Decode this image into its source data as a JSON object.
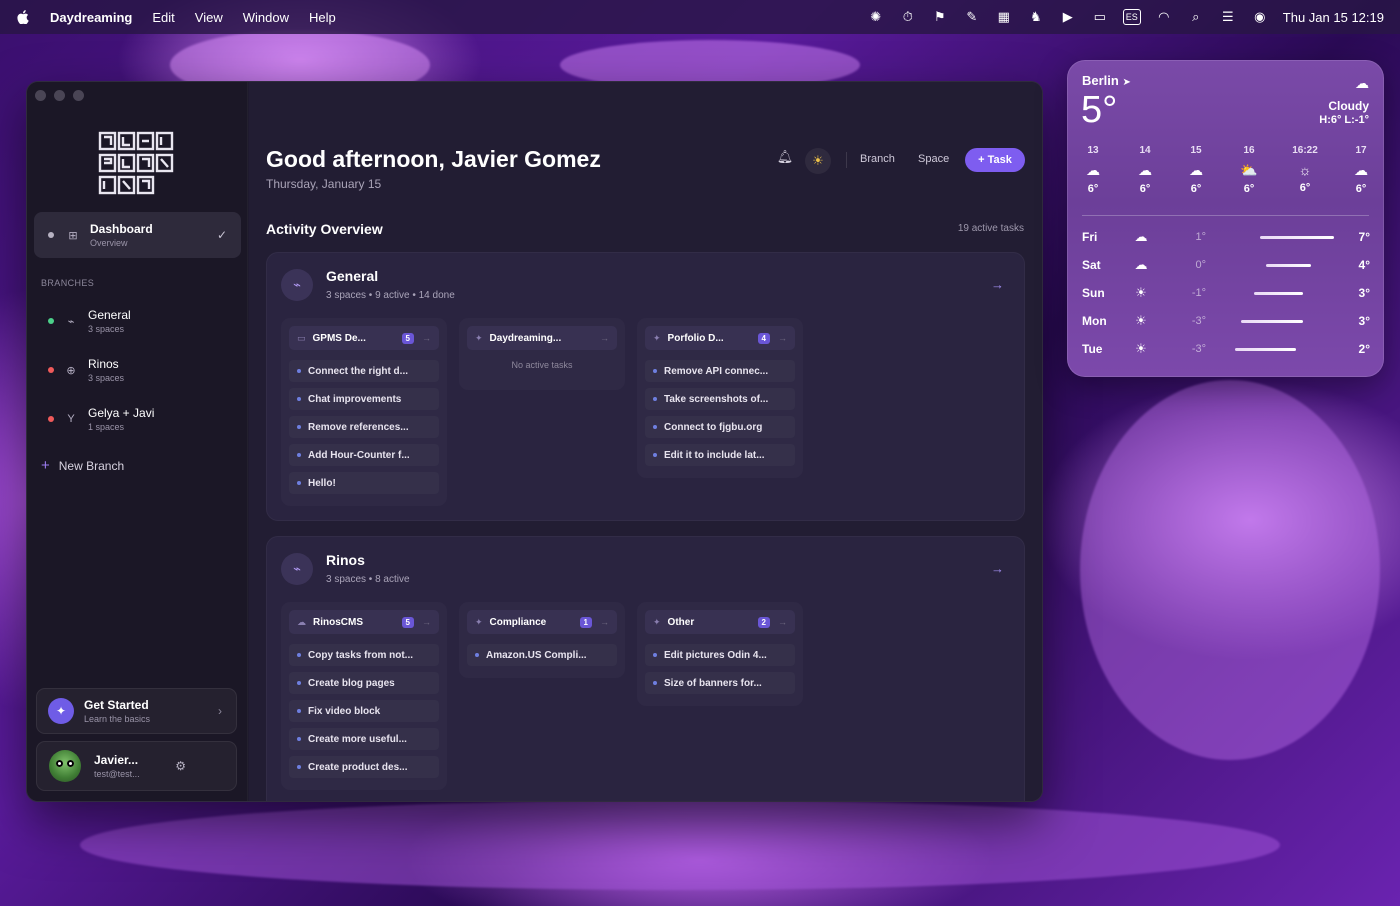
{
  "menubar": {
    "app": "Daydreaming",
    "items": [
      "Edit",
      "View",
      "Window",
      "Help"
    ],
    "input_source": "ES",
    "clock": "Thu Jan 15  12:19"
  },
  "sidebar": {
    "dashboard": {
      "label": "Dashboard",
      "sub": "Overview"
    },
    "branches_heading": "BRANCHES",
    "branches": [
      {
        "label": "General",
        "sub": "3 spaces",
        "color": "#4cd08a"
      },
      {
        "label": "Rinos",
        "sub": "3 spaces",
        "color": "#f05a5a"
      },
      {
        "label": "Gelya + Javi",
        "sub": "1 spaces",
        "color": "#f05a5a"
      }
    ],
    "new_branch": "New Branch",
    "get_started": {
      "title": "Get Started",
      "sub": "Learn the basics"
    },
    "user": {
      "name": "Javier...",
      "email": "test@test..."
    }
  },
  "header": {
    "greeting": "Good afternoon, Javier Gomez",
    "date": "Thursday, January 15",
    "branch_label": "Branch",
    "space_label": "Space",
    "task_label": "+ Task"
  },
  "activity": {
    "title": "Activity Overview",
    "count": "19 active tasks"
  },
  "groups": [
    {
      "title": "General",
      "meta": "3 spaces • 9 active • 14 done",
      "spaces": [
        {
          "name": "GPMS De...",
          "badge": "5",
          "tasks": [
            "Connect the right d...",
            "Chat improvements",
            "Remove references...",
            "Add Hour-Counter f...",
            "Hello!"
          ]
        },
        {
          "name": "Daydreaming...",
          "badge": "",
          "empty": "No active tasks",
          "tasks": []
        },
        {
          "name": "Porfolio D...",
          "badge": "4",
          "tasks": [
            "Remove API connec...",
            "Take screenshots of...",
            "Connect to fjgbu.org",
            "Edit it to include lat..."
          ]
        }
      ]
    },
    {
      "title": "Rinos",
      "meta": "3 spaces • 8 active",
      "spaces": [
        {
          "name": "RinosCMS",
          "badge": "5",
          "tasks": [
            "Copy tasks from not...",
            "Create blog pages",
            "Fix video block",
            "Create more useful...",
            "Create product des..."
          ]
        },
        {
          "name": "Compliance",
          "badge": "1",
          "tasks": [
            "Amazon.US Compli..."
          ]
        },
        {
          "name": "Other",
          "badge": "2",
          "tasks": [
            "Edit pictures Odin 4...",
            "Size of banners for..."
          ]
        }
      ]
    }
  ],
  "weather": {
    "city": "Berlin",
    "temp": "5°",
    "condition": "Cloudy",
    "hilo": "H:6° L:-1°",
    "hourly": [
      {
        "t": "13",
        "v": "6°",
        "icon": "cloud-icon"
      },
      {
        "t": "14",
        "v": "6°",
        "icon": "cloud-icon"
      },
      {
        "t": "15",
        "v": "6°",
        "icon": "cloud-icon"
      },
      {
        "t": "16",
        "v": "6°",
        "icon": "partly-cloudy-icon"
      },
      {
        "t": "16:22",
        "v": "6°",
        "icon": "sunset-icon"
      },
      {
        "t": "17",
        "v": "6°",
        "icon": "cloud-icon"
      }
    ],
    "daily": [
      {
        "d": "Fri",
        "lo": "1°",
        "hi": "7°",
        "icon": "cloud-icon"
      },
      {
        "d": "Sat",
        "lo": "0°",
        "hi": "4°",
        "icon": "cloud-icon"
      },
      {
        "d": "Sun",
        "lo": "-1°",
        "hi": "3°",
        "icon": "sun-icon"
      },
      {
        "d": "Mon",
        "lo": "-3°",
        "hi": "3°",
        "icon": "sun-icon"
      },
      {
        "d": "Tue",
        "lo": "-3°",
        "hi": "2°",
        "icon": "sun-icon"
      }
    ]
  }
}
